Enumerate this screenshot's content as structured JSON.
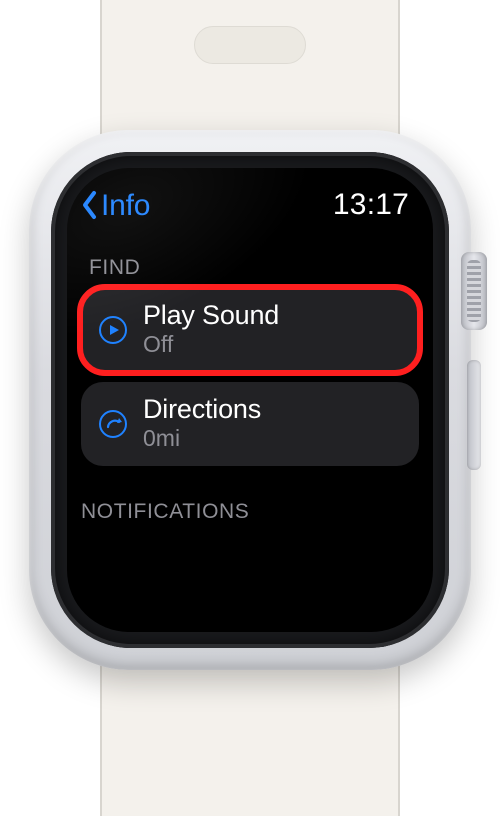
{
  "status": {
    "back_label": "Info",
    "time": "13:17"
  },
  "sections": {
    "find_header": "FIND",
    "notifications_header": "NOTIFICATIONS"
  },
  "rows": {
    "play_sound": {
      "title": "Play Sound",
      "subtitle": "Off"
    },
    "directions": {
      "title": "Directions",
      "subtitle": "0mi"
    }
  },
  "colors": {
    "accent_blue": "#1f82ff",
    "highlight_red": "#ff1f1f",
    "row_bg": "#222225",
    "muted": "#8f8f96"
  }
}
